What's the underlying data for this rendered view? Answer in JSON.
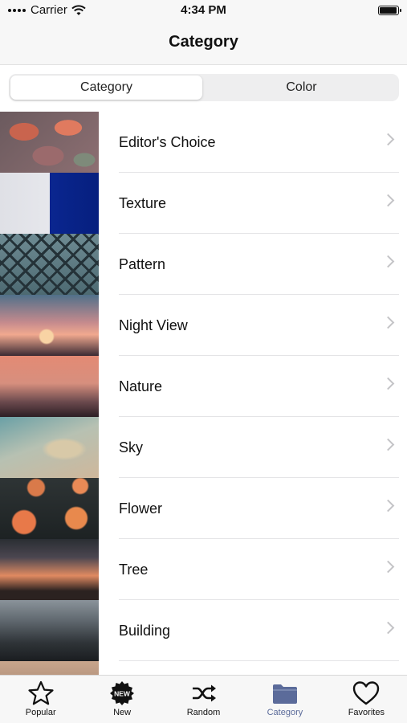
{
  "status_bar": {
    "carrier": "Carrier",
    "time": "4:34 PM",
    "battery_level": 1.0
  },
  "nav": {
    "title": "Category"
  },
  "segmented": {
    "options": [
      "Category",
      "Color"
    ],
    "selected": "Category"
  },
  "categories": [
    {
      "label": "Editor's Choice"
    },
    {
      "label": "Texture"
    },
    {
      "label": "Pattern"
    },
    {
      "label": "Night View"
    },
    {
      "label": "Nature"
    },
    {
      "label": "Sky"
    },
    {
      "label": "Flower"
    },
    {
      "label": "Tree"
    },
    {
      "label": "Building"
    }
  ],
  "tab_bar": {
    "items": [
      {
        "label": "Popular",
        "icon": "star-icon"
      },
      {
        "label": "New",
        "icon": "new-badge-icon",
        "badge_text": "NEW"
      },
      {
        "label": "Random",
        "icon": "shuffle-icon"
      },
      {
        "label": "Category",
        "icon": "folder-icon"
      },
      {
        "label": "Favorites",
        "icon": "heart-icon"
      }
    ],
    "active": "Category",
    "active_color": "#5b6b9a"
  }
}
